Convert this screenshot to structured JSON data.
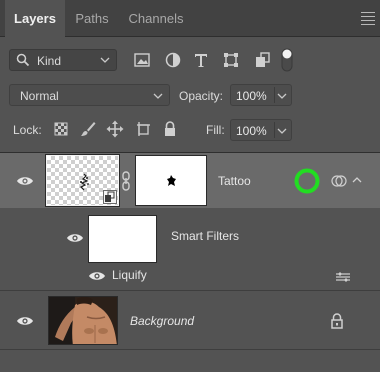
{
  "tabs": [
    {
      "label": "Layers",
      "active": true
    },
    {
      "label": "Paths",
      "active": false
    },
    {
      "label": "Channels",
      "active": false
    }
  ],
  "filter": {
    "kind_label": "Kind",
    "icons": [
      "image-filter-icon",
      "adjustment-filter-icon",
      "type-filter-icon",
      "shape-filter-icon",
      "smart-object-filter-icon",
      "filter-toggle-icon"
    ]
  },
  "blend": {
    "mode": "Normal",
    "opacity_label": "Opacity:",
    "opacity_value": "100%"
  },
  "locks": {
    "label": "Lock:",
    "icons": [
      "lock-transparent-pixels-icon",
      "lock-image-pixels-icon",
      "lock-position-icon",
      "lock-artboard-icon",
      "lock-all-icon"
    ],
    "fill_label": "Fill:",
    "fill_value": "100%"
  },
  "layers": {
    "tattoo": {
      "name": "Tattoo",
      "selected": true
    },
    "smart_filters": {
      "label": "Smart Filters",
      "filter_name": "Liquify"
    },
    "background": {
      "name": "Background",
      "locked": true
    }
  },
  "colors": {
    "panel_bg": "#535353",
    "tab_bar_bg": "#424242",
    "selected_row_bg": "#6a6a6a",
    "highlight_circle": "#22dd22"
  }
}
